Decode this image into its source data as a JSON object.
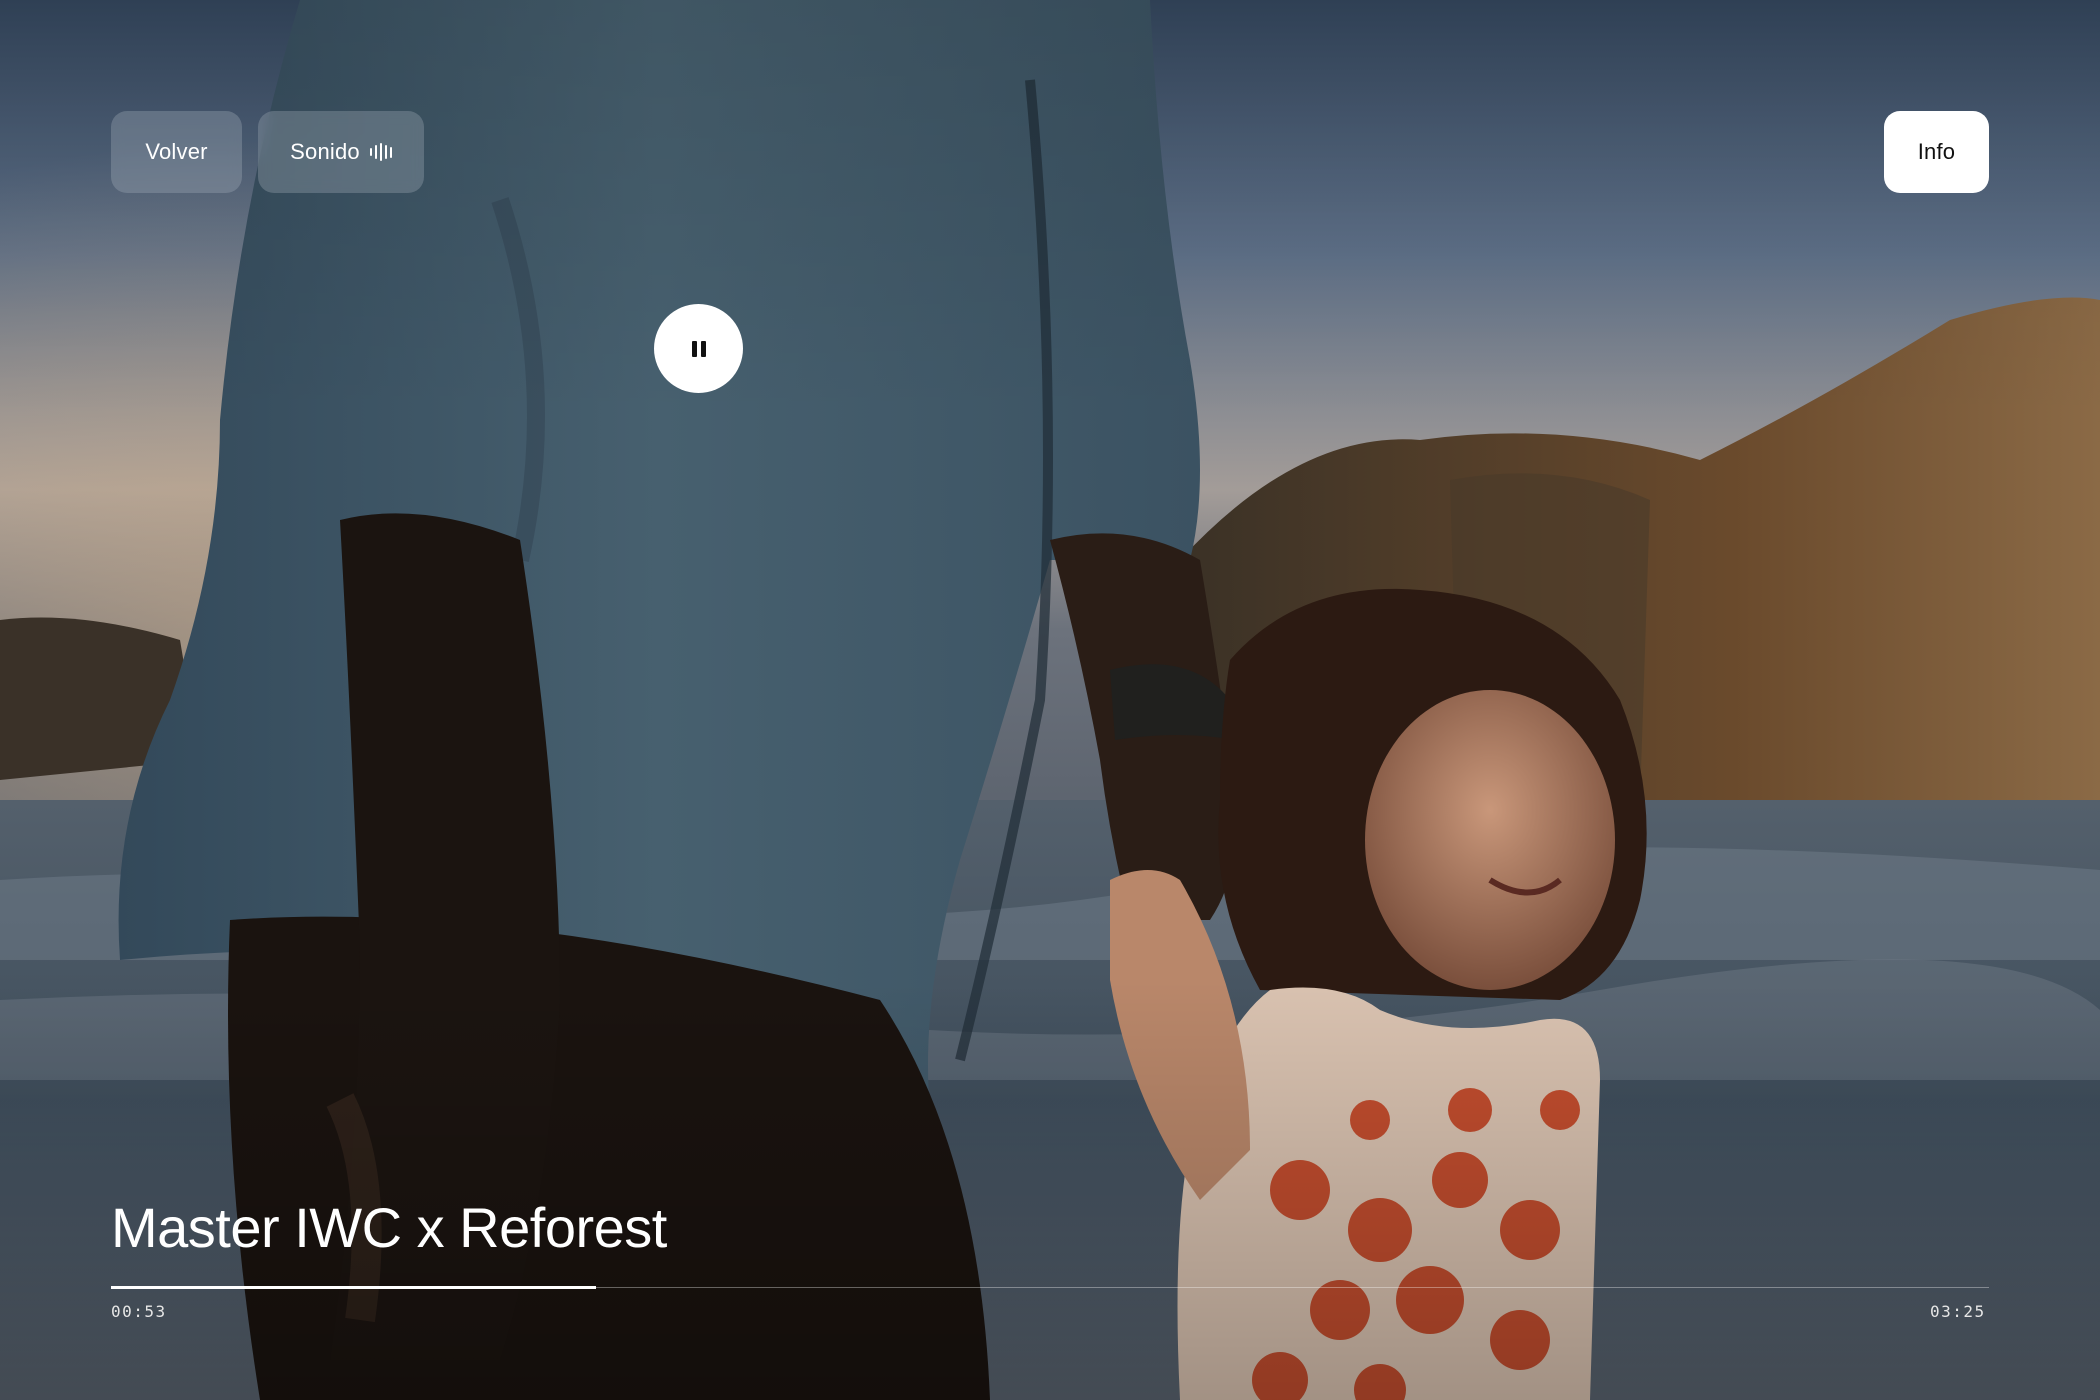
{
  "player": {
    "title": "Master IWC x Reforest",
    "current_time": "00:53",
    "total_time": "03:25",
    "progress_fraction": 0.2585,
    "state": "playing"
  },
  "controls": {
    "back_label": "Volver",
    "sound_label": "Sonido",
    "info_label": "Info",
    "pause_icon": "pause-icon",
    "sound_icon": "sound-bars-icon"
  },
  "colors": {
    "glass_button": "#afb9c3",
    "info_button_bg": "#ffffff",
    "text_primary": "#ffffff",
    "progress_fill": "#ffffff"
  }
}
